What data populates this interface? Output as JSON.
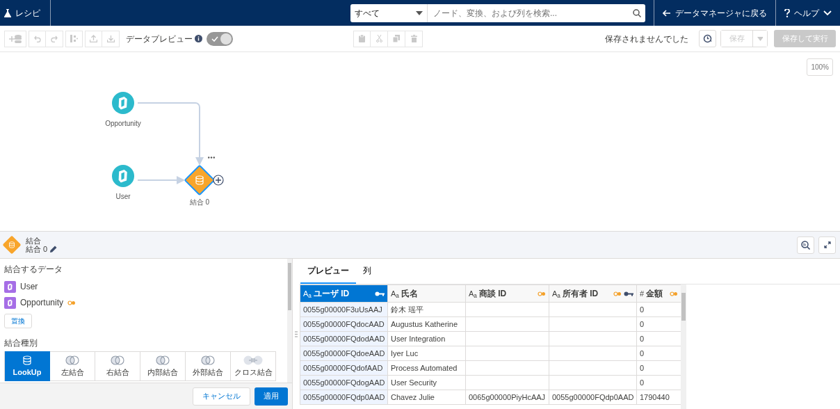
{
  "header": {
    "app_title": "レシピ",
    "search": {
      "scope": "すべて",
      "placeholder": "ノード、変換、および列を検索..."
    },
    "back_link": "データマネージャに戻る",
    "help": "ヘルプ"
  },
  "toolbar": {
    "preview_label": "データプレビュー",
    "preview_on": true,
    "save_status": "保存されませんでした",
    "save": "保存",
    "save_run": "保存して実行"
  },
  "canvas": {
    "zoom": "100%",
    "nodes": [
      {
        "kind": "source",
        "label": "Opportunity",
        "selected": false
      },
      {
        "kind": "source",
        "label": "User",
        "selected": false
      },
      {
        "kind": "join",
        "label": "結合 0",
        "selected": true
      }
    ]
  },
  "panel": {
    "type_label": "結合",
    "node_name": "結合 0",
    "data_heading": "結合するデータ",
    "sources": [
      {
        "label": "User",
        "linked": false
      },
      {
        "label": "Opportunity",
        "linked": true
      }
    ],
    "replace": "置換",
    "join_type_heading": "結合種別",
    "join_types": [
      {
        "kind": "lookup",
        "label": "LookUp",
        "selected": true
      },
      {
        "kind": "venn",
        "label": "左結合",
        "selected": false
      },
      {
        "kind": "venn",
        "label": "右結合",
        "selected": false
      },
      {
        "kind": "venn",
        "label": "内部結合",
        "selected": false
      },
      {
        "kind": "venn",
        "label": "外部結合",
        "selected": false
      },
      {
        "kind": "cross",
        "label": "クロス結合",
        "selected": false
      }
    ],
    "cancel": "キャンセル",
    "apply": "適用"
  },
  "preview": {
    "tabs": [
      {
        "label": "プレビュー",
        "selected": true
      },
      {
        "label": "列",
        "selected": false
      }
    ],
    "columns": [
      {
        "type_mark": "A$_{a}$",
        "label": "ユーザ ID",
        "key": true,
        "linked": false,
        "selected": true
      },
      {
        "type_mark": "A$_{a}$",
        "label": "氏名",
        "key": false,
        "linked": false,
        "selected": false
      },
      {
        "type_mark": "A$_{a}$",
        "label": "商談 ID",
        "key": false,
        "linked": true,
        "selected": false
      },
      {
        "type_mark": "A$_{a}$",
        "label": "所有者 ID",
        "key": true,
        "linked": true,
        "selected": false
      },
      {
        "type_mark": "#",
        "label": "金額",
        "key": false,
        "linked": true,
        "selected": false
      }
    ],
    "rows": [
      [
        "0055g00000F3uUsAAJ",
        "鈴木 瑶平",
        "",
        "",
        "0"
      ],
      [
        "0055g00000FQdocAAD",
        "Augustus Katherine",
        "",
        "",
        "0"
      ],
      [
        "0055g00000FQdodAAD",
        "User Integration",
        "",
        "",
        "0"
      ],
      [
        "0055g00000FQdoeAAD",
        "Iyer Luc",
        "",
        "",
        "0"
      ],
      [
        "0055g00000FQdofAAD",
        "Process Automated",
        "",
        "",
        "0"
      ],
      [
        "0055g00000FQdogAAD",
        "User Security",
        "",
        "",
        "0"
      ],
      [
        "0055g00000FQdp0AAD",
        "Chavez Julie",
        "0065g00000PiyHcAAJ",
        "0055g00000FQdp0AAD",
        "1790440"
      ]
    ]
  }
}
